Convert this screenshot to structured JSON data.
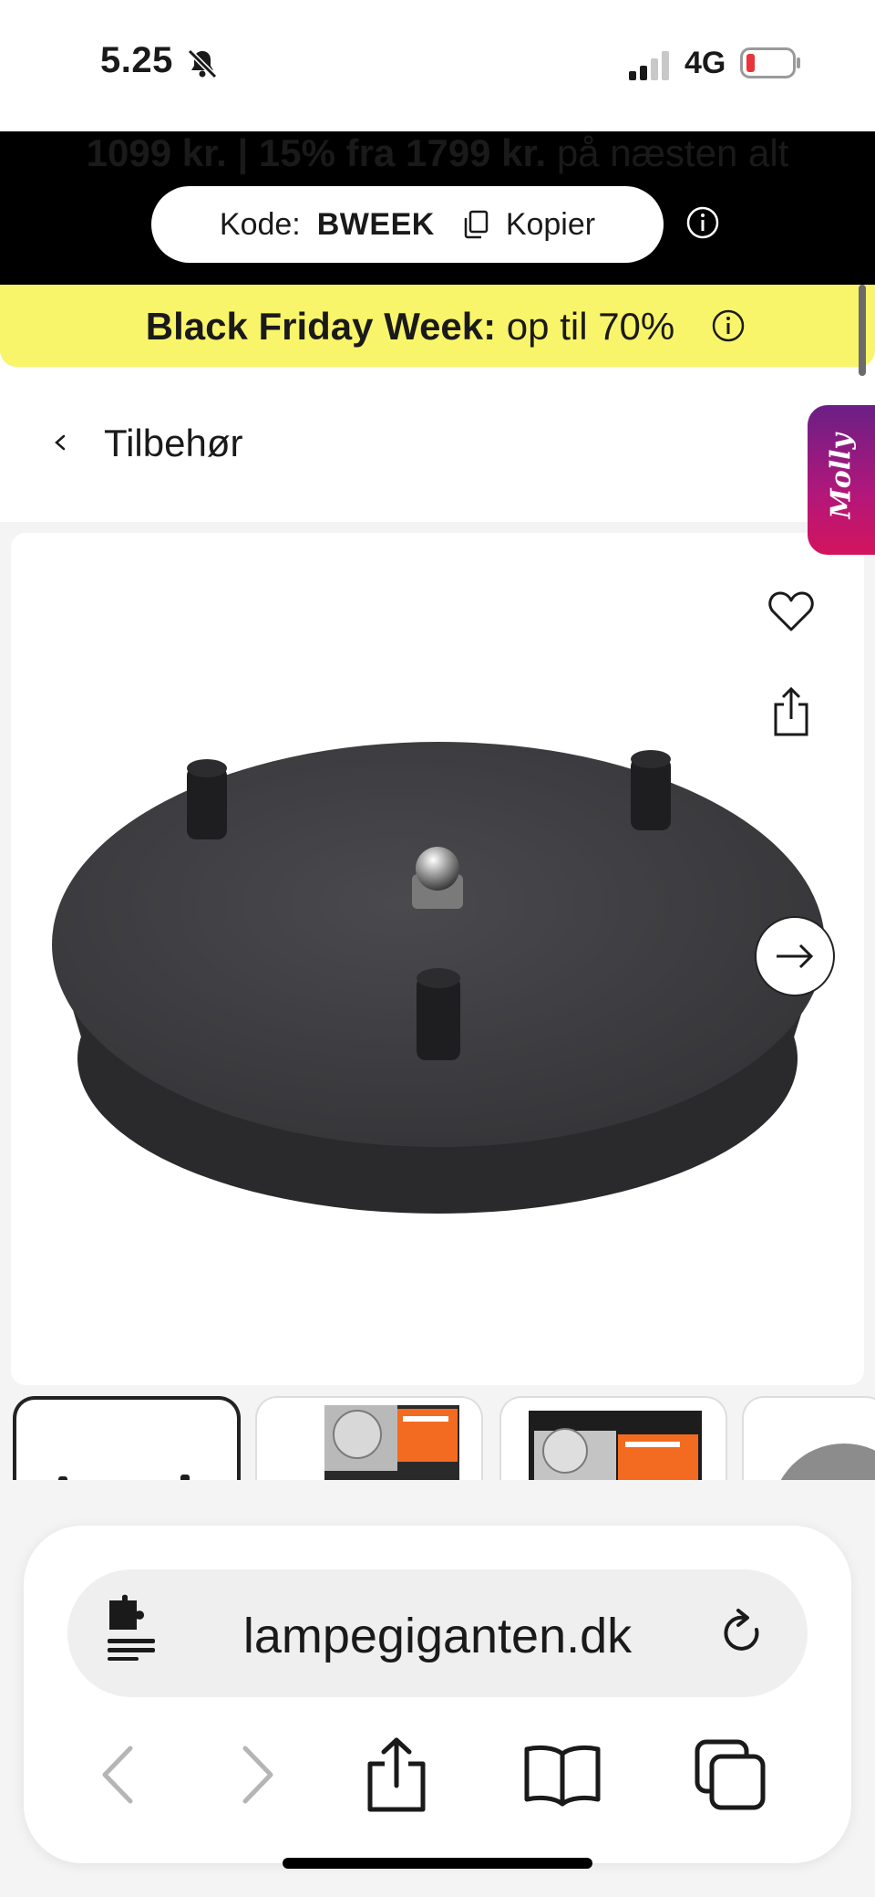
{
  "status_bar": {
    "time": "5.25",
    "network": "4G",
    "icons": [
      "bell-slash-icon",
      "signal-icon",
      "battery-low-icon"
    ],
    "battery_color": "#e8343a"
  },
  "promo": {
    "price_text": "1099 kr. | 15% fra 1799 kr.",
    "suffix_text": " på næsten alt",
    "code_label": "Kode:",
    "code_value": "BWEEK",
    "copy_label": "Kopier"
  },
  "black_friday": {
    "title": "Black Friday Week:",
    "text": " op til 70%",
    "background": "#f9f56a"
  },
  "breadcrumb": {
    "label": "Tilbehør"
  },
  "chat_tab": {
    "label": "Molly"
  },
  "gallery": {
    "icons": [
      "heart-icon",
      "share-icon",
      "arrow-right-icon"
    ],
    "thumbnail_count": 4
  },
  "browser": {
    "url": "lampegiganten.dk",
    "toolbar": [
      "back",
      "forward",
      "share",
      "bookmarks",
      "tabs"
    ]
  }
}
